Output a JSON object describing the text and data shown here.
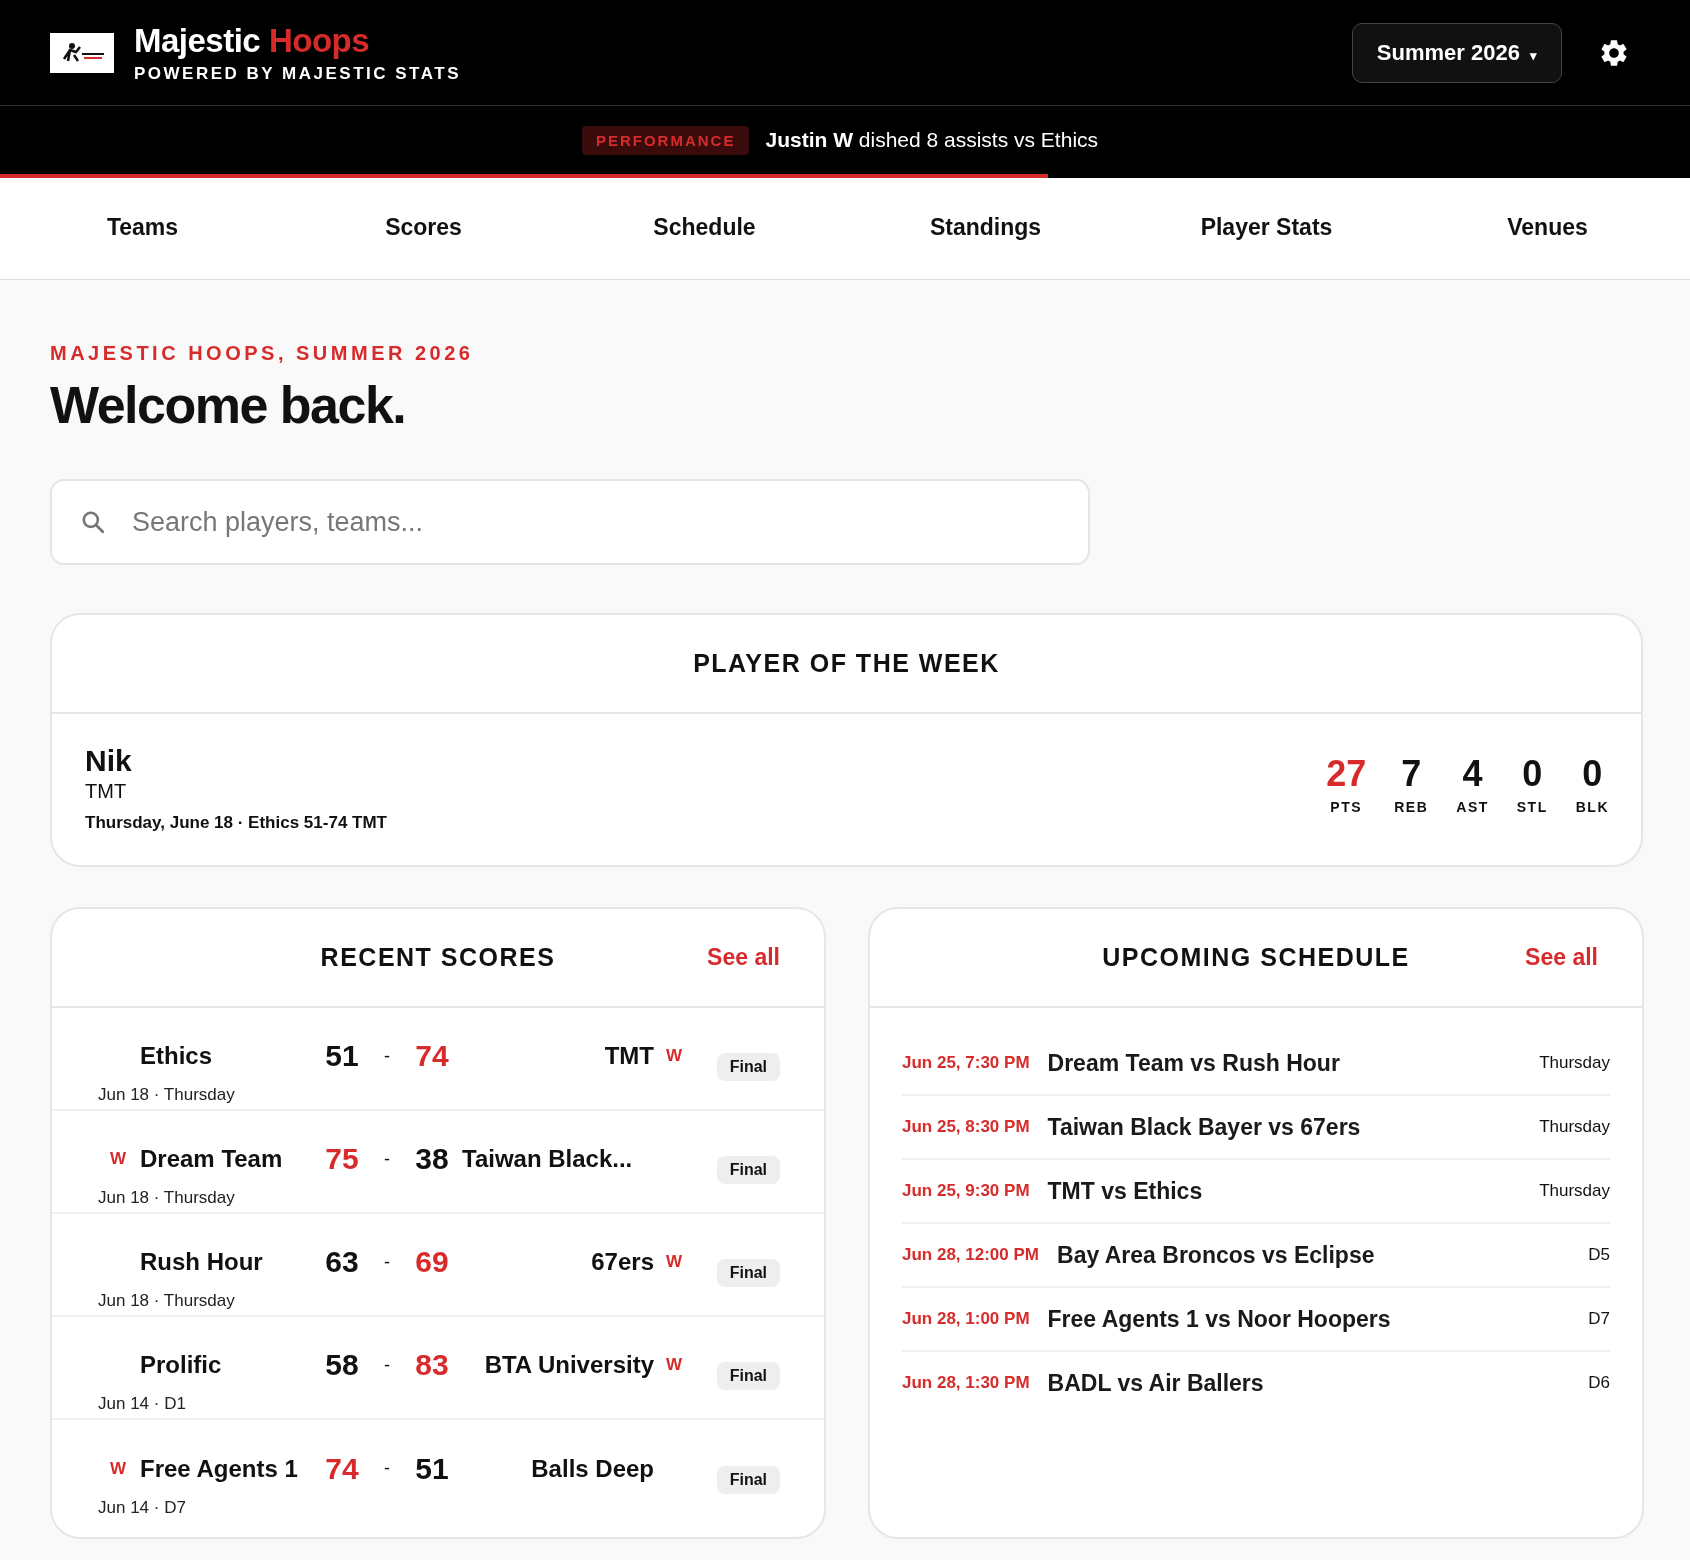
{
  "header": {
    "brand_first": "Majestic",
    "brand_second": "Hoops",
    "tagline": "POWERED BY MAJESTIC STATS",
    "season": "Summer 2026",
    "season_caret": "▾"
  },
  "ticker": {
    "tag": "PERFORMANCE",
    "text": "**Justin W** dished 8 assists vs Ethics",
    "level": 0.62
  },
  "tabs": [
    {
      "label": "Teams",
      "selected": false
    },
    {
      "label": "Scores",
      "selected": false
    },
    {
      "label": "Schedule",
      "selected": false
    },
    {
      "label": "Standings",
      "selected": false
    },
    {
      "label": "Player Stats",
      "selected": false
    },
    {
      "label": "Venues",
      "selected": false
    }
  ],
  "eyebrow": "MAJESTIC HOOPS, SUMMER 2026",
  "title": "Welcome back.",
  "search": {
    "placeholder": "Search players, teams..."
  },
  "player_of_week": {
    "title": "PLAYER OF THE WEEK",
    "name": "Nik",
    "team": "TMT",
    "game": "Thursday, June 18 · Ethics 51-74 TMT",
    "stats": [
      {
        "value": "27",
        "label": "PTS",
        "highlight": true
      },
      {
        "value": "7",
        "label": "REB",
        "highlight": false
      },
      {
        "value": "4",
        "label": "AST",
        "highlight": false
      },
      {
        "value": "0",
        "label": "STL",
        "highlight": false
      },
      {
        "value": "0",
        "label": "BLK",
        "highlight": false
      }
    ]
  },
  "recent_scores": {
    "title": "RECENT SCORES",
    "link": "See all",
    "games": [
      {
        "home": {
          "name": "Ethics",
          "score": "51",
          "winner": false
        },
        "away": {
          "name": "TMT",
          "score": "74",
          "winner": true
        },
        "win_mark": "W",
        "separator": "-",
        "meta": "Jun 18 · Thursday",
        "status": "Final"
      },
      {
        "home": {
          "name": "Dream Team",
          "score": "75",
          "winner": true
        },
        "away": {
          "name": "Taiwan Black...",
          "score": "38",
          "winner": false
        },
        "win_mark": "W",
        "separator": "-",
        "meta": "Jun 18 · Thursday",
        "status": "Final"
      },
      {
        "home": {
          "name": "Rush Hour",
          "score": "63",
          "winner": false
        },
        "away": {
          "name": "67ers",
          "score": "69",
          "winner": true
        },
        "win_mark": "W",
        "separator": "-",
        "meta": "Jun 18 · Thursday",
        "status": "Final"
      },
      {
        "home": {
          "name": "Prolific",
          "score": "58",
          "winner": false
        },
        "away": {
          "name": "BTA University",
          "score": "83",
          "winner": true
        },
        "win_mark": "W",
        "separator": "-",
        "meta": "Jun 14 · D1",
        "status": "Final"
      },
      {
        "home": {
          "name": "Free Agents 1",
          "score": "74",
          "winner": true
        },
        "away": {
          "name": "Balls Deep",
          "score": "51",
          "winner": false
        },
        "win_mark": "W",
        "separator": "-",
        "meta": "Jun 14 · D7",
        "status": "Final"
      }
    ]
  },
  "upcoming_schedule": {
    "title": "UPCOMING SCHEDULE",
    "link": "See all",
    "games": [
      {
        "time": "Jun 25, 7:30 PM",
        "matchup": "Dream Team vs Rush Hour",
        "day": "Thursday"
      },
      {
        "time": "Jun 25, 8:30 PM",
        "matchup": "Taiwan Black Bayer vs 67ers",
        "day": "Thursday"
      },
      {
        "time": "Jun 25, 9:30 PM",
        "matchup": "TMT vs Ethics",
        "day": "Thursday"
      },
      {
        "time": "Jun 28, 12:00 PM",
        "matchup": "Bay Area Broncos vs Eclipse",
        "day": "D5"
      },
      {
        "time": "Jun 28, 1:00 PM",
        "matchup": "Free Agents 1 vs Noor Hoopers",
        "day": "D7"
      },
      {
        "time": "Jun 28, 1:30 PM",
        "matchup": "BADL vs Air Ballers",
        "day": "D6"
      }
    ]
  }
}
